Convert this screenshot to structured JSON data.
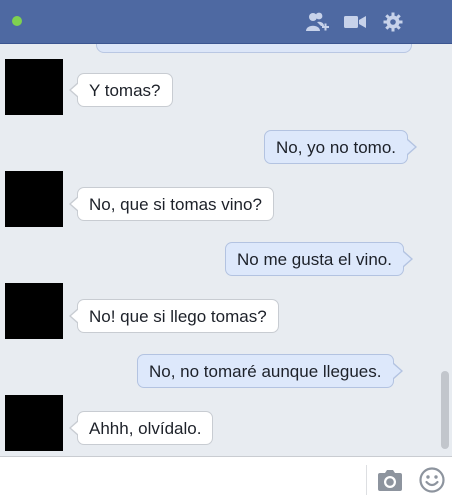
{
  "header": {
    "status": "online",
    "icons": [
      "add-friend-icon",
      "video-call-icon",
      "gear-icon"
    ]
  },
  "messages": [
    {
      "direction": "incoming",
      "text": "Y tomas?"
    },
    {
      "direction": "outgoing",
      "text": "No, yo no tomo."
    },
    {
      "direction": "incoming",
      "text": "No, que si tomas vino?"
    },
    {
      "direction": "outgoing",
      "text": "No me gusta el vino."
    },
    {
      "direction": "incoming",
      "text": "No! que si llego tomas?"
    },
    {
      "direction": "outgoing",
      "text": "No, no tomaré aunque llegues."
    },
    {
      "direction": "incoming",
      "text": "Ahhh, olvídalo."
    }
  ],
  "composer": {
    "value": "",
    "placeholder": "",
    "icons": [
      "camera-icon",
      "emoji-icon"
    ]
  },
  "colors": {
    "header_bg": "#4e69a2",
    "online_dot": "#7fd14f",
    "incoming_bubble": "#ffffff",
    "outgoing_bubble": "#dde8fb",
    "chat_bg": "#e8ecf1"
  }
}
